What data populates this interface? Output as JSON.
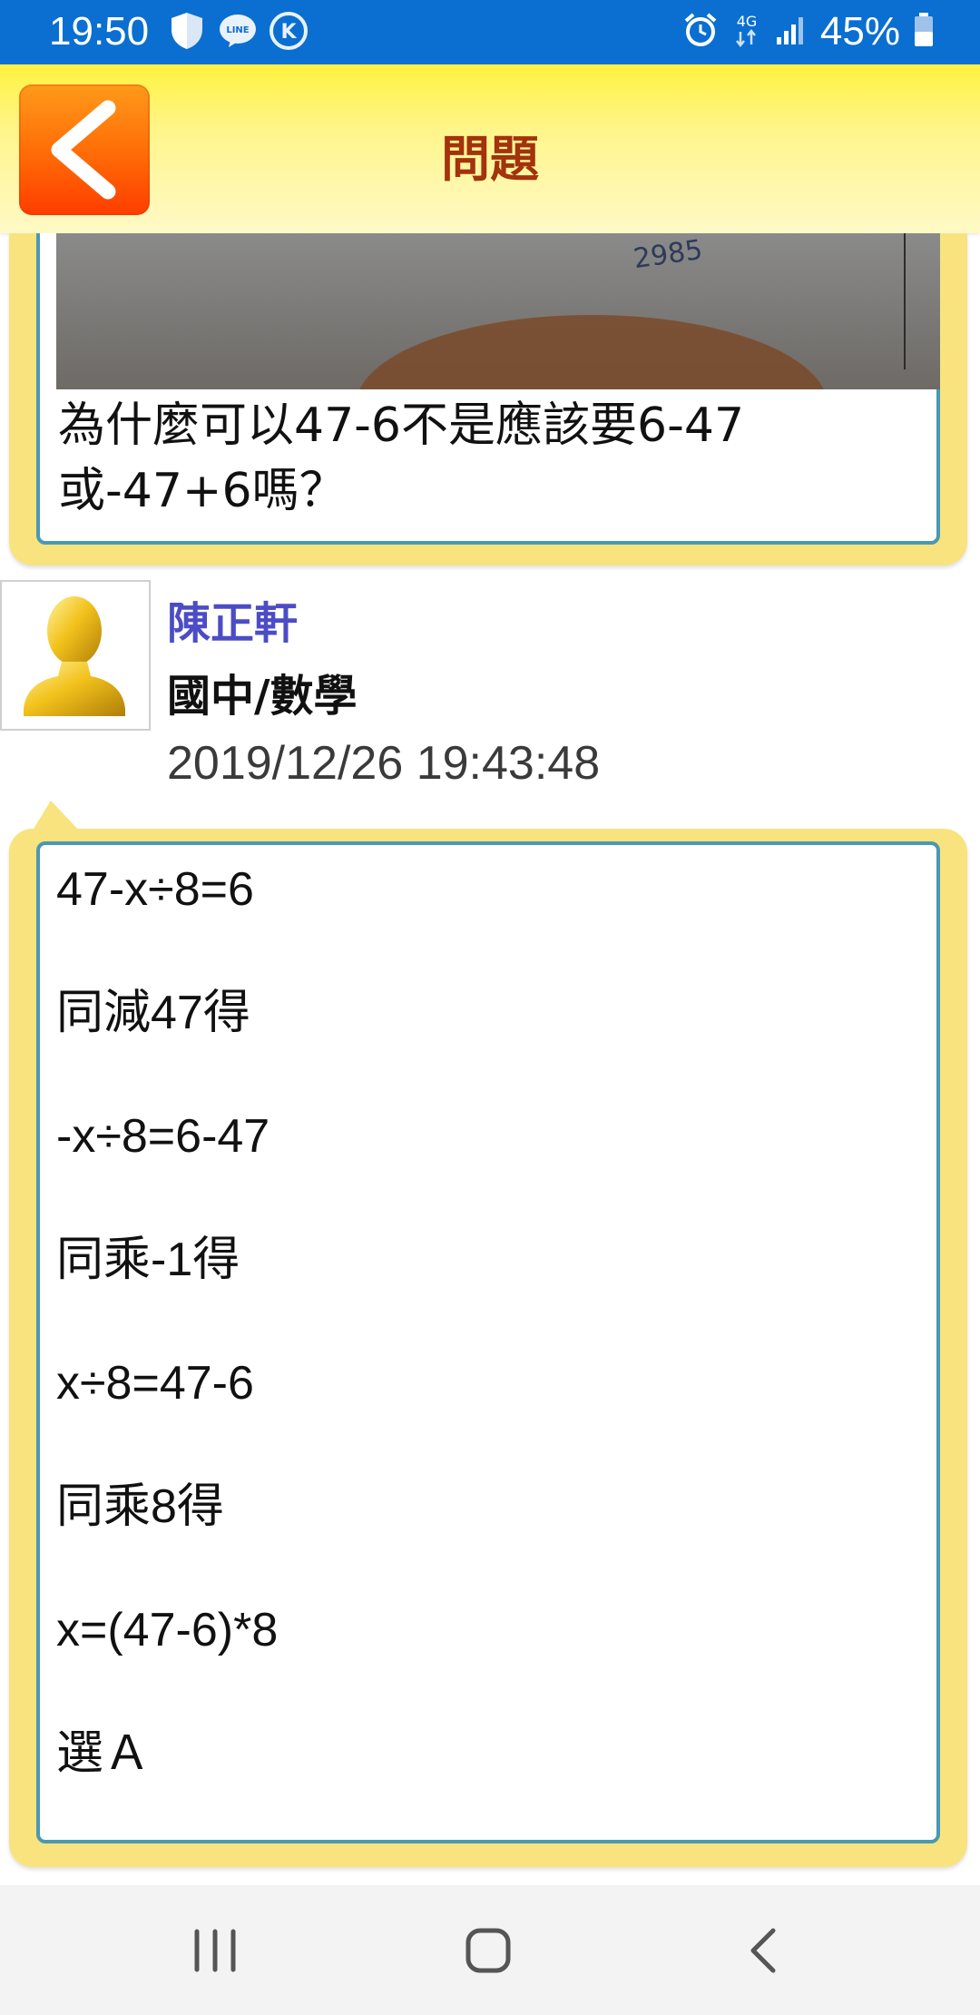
{
  "status_bar": {
    "time": "19:50",
    "battery_percent": "45%",
    "network": "4G",
    "icons": [
      "shield-icon",
      "line-icon",
      "k-icon",
      "alarm-icon",
      "network-4g-icon",
      "signal-icon",
      "battery-icon"
    ]
  },
  "header": {
    "title": "問題",
    "back_icon": "chevron-left-icon"
  },
  "question": {
    "text": "為什麼可以47-6不是應該要6-47或-47+6嗎？",
    "photo_text": "2985"
  },
  "answer": {
    "author": "陳正軒",
    "subject": "國中/數學",
    "timestamp": "2019/12/26 19:43:48",
    "lines": [
      "47-x÷8=6",
      "同減47得",
      "-x÷8=6-47",
      "同乘-1得",
      "x÷8=47-6",
      "同乘8得",
      "x=(47-6)*8",
      "選Ａ"
    ]
  },
  "nav_bar": {
    "items": [
      "recent-apps-icon",
      "home-icon",
      "back-icon"
    ]
  },
  "colors": {
    "status_bar": "#0a6fd1",
    "header_gradient_top": "#fff23f",
    "back_button": "#ff6a06",
    "title": "#a3320d",
    "bubble": "#f8e37e",
    "inner_border": "#4a99b2",
    "author": "#4c4cc6"
  }
}
